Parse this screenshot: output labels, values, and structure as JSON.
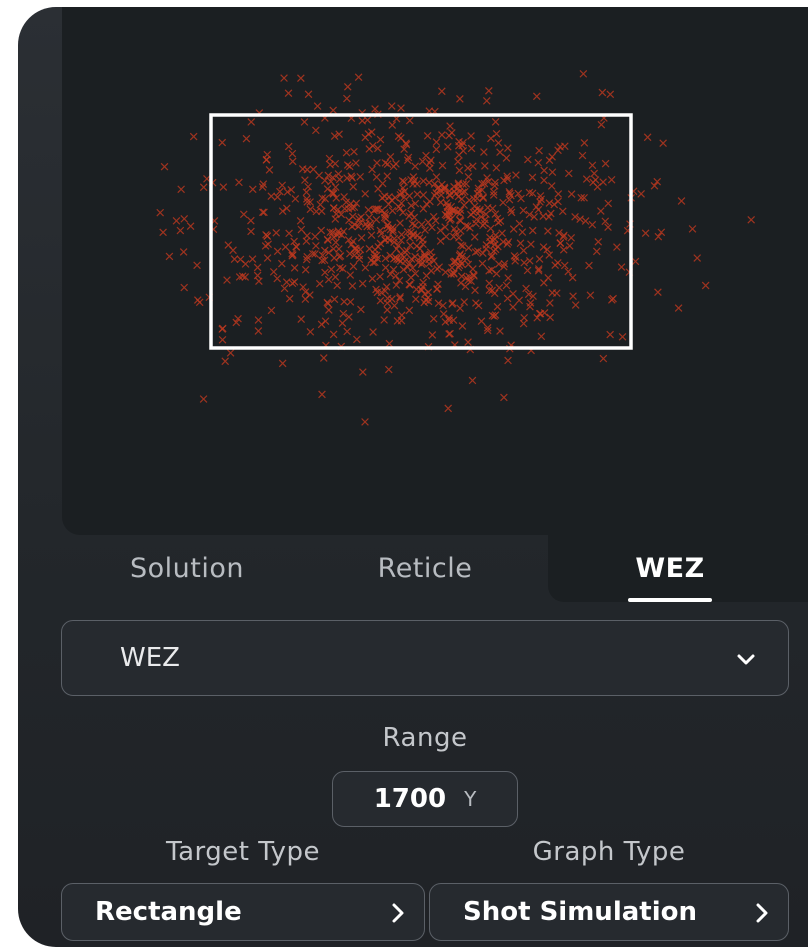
{
  "tabs": [
    {
      "label": "Solution",
      "active": false
    },
    {
      "label": "Reticle",
      "active": false
    },
    {
      "label": "WEZ",
      "active": true
    }
  ],
  "mode_dropdown": {
    "value": "WEZ",
    "icon": "chevron-down-icon"
  },
  "range": {
    "label": "Range",
    "value": "1700",
    "unit": "Y"
  },
  "target_type": {
    "label": "Target Type",
    "value": "Rectangle",
    "icon": "chevron-right-icon"
  },
  "graph_type": {
    "label": "Graph Type",
    "value": "Shot Simulation",
    "icon": "chevron-right-icon"
  },
  "colors": {
    "background": "#23272b",
    "plot_background": "#1b1f22",
    "shot_marker": "#c0391f",
    "target_outline": "#ffffff",
    "active_tab": "#ffffff",
    "inactive_tab": "#b8bcc1"
  },
  "plot": {
    "marker": "x",
    "shot_count_approx": 900,
    "target_shape": "rectangle"
  }
}
